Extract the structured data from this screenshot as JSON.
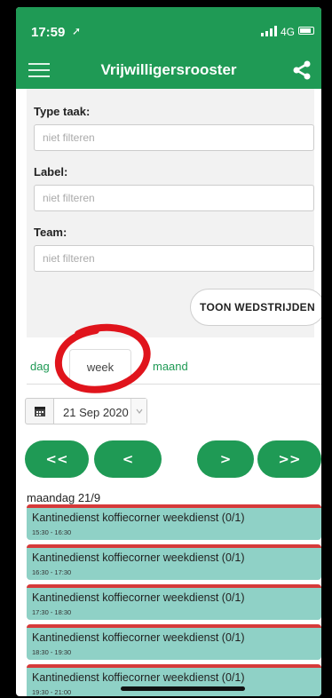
{
  "status": {
    "time": "17:59",
    "network": "4G"
  },
  "app": {
    "title": "Vrijwilligersrooster"
  },
  "filters": [
    {
      "label": "Type taak:",
      "placeholder": "niet filteren"
    },
    {
      "label": "Label:",
      "placeholder": "niet filteren"
    },
    {
      "label": "Team:",
      "placeholder": "niet filteren"
    }
  ],
  "filter_button": "TOON WEDSTRIJDEN",
  "tabs": {
    "day": "dag",
    "week": "week",
    "month": "maand",
    "active": "week"
  },
  "date": {
    "selected": "21 Sep 2020"
  },
  "nav": {
    "first": "<<",
    "prev": "<",
    "next": ">",
    "last": ">>"
  },
  "schedule": {
    "day_header": "maandag 21/9",
    "entries": [
      {
        "title": "Kantinedienst koffiecorner weekdienst (0/1)",
        "time": "15:30 - 16:30"
      },
      {
        "title": "Kantinedienst koffiecorner weekdienst (0/1)",
        "time": "16:30 - 17:30"
      },
      {
        "title": "Kantinedienst koffiecorner weekdienst (0/1)",
        "time": "17:30 - 18:30"
      },
      {
        "title": "Kantinedienst koffiecorner weekdienst (0/1)",
        "time": "18:30 - 19:30"
      },
      {
        "title": "Kantinedienst koffiecorner weekdienst (0/1)",
        "time": "19:30 - 21:00"
      }
    ]
  },
  "colors": {
    "brand": "#1f9a55",
    "entry_bg": "#8fd1c6",
    "entry_border": "#d63a3a",
    "annotation": "#e0141c"
  },
  "icons": [
    "menu-icon",
    "share-icon",
    "calendar-icon",
    "chevron-down-icon"
  ]
}
